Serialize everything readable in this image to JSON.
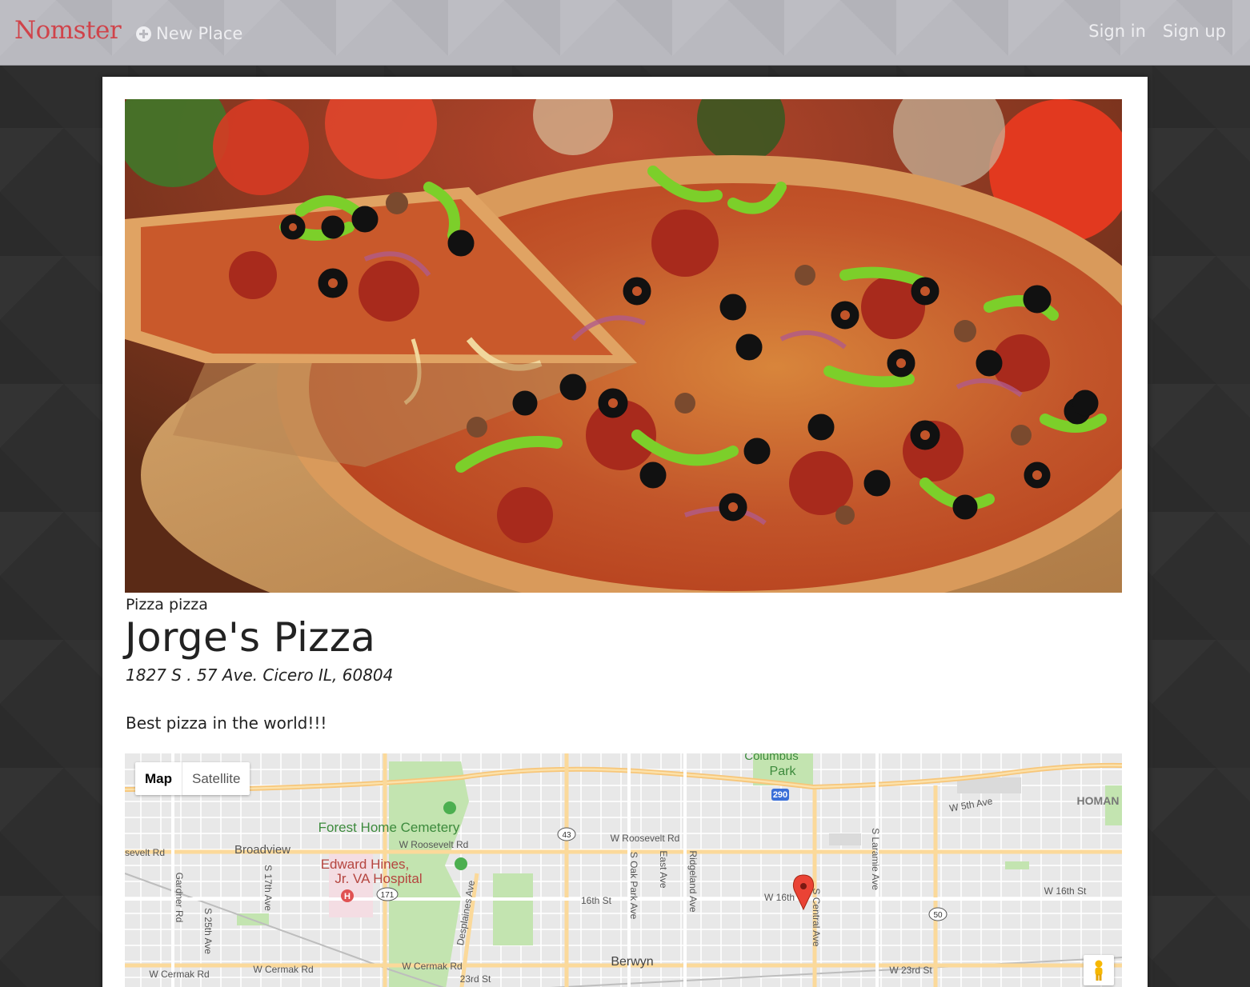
{
  "navbar": {
    "brand": "Nomster",
    "new_place": "New Place",
    "sign_in": "Sign in",
    "sign_up": "Sign up"
  },
  "place": {
    "category": "Pizza pizza",
    "name": "Jorge's Pizza",
    "address": "1827 S . 57 Ave. Cicero IL, 60804",
    "description": "Best pizza in the world!!!"
  },
  "map": {
    "map_button": "Map",
    "satellite_button": "Satellite",
    "labels": {
      "columbus": "Columbus",
      "park": "Park",
      "forest_home": "Forest Home Cemetery",
      "broadview": "Broadview",
      "hines_1": "Edward Hines,",
      "hines_2": "Jr. VA Hospital",
      "berwyn": "Berwyn",
      "w_roosevelt_rd": "W Roosevelt Rd",
      "w_roosevelt_rd_2": "W Roosevelt Rd",
      "sevelt_rd": "sevelt Rd",
      "w_5th_ave": "W 5th Ave",
      "homan": "HOMAN",
      "w_16th_st": "W 16th St",
      "w_16th": "W 16th",
      "16th_st": "16th St",
      "w_cermak_rd_1": "W Cermak Rd",
      "w_cermak_rd_2": "W Cermak Rd",
      "w_cermak_rd_3": "W Cermak Rd",
      "23rd_st": "23rd St",
      "w_23rd_st": "W 23rd St",
      "gardner_rd": "Gardner Rd",
      "s_17th_ave": "S 17th Ave",
      "s_25th_ave": "S 25th Ave",
      "desplaines_ave": "Desplaines Ave",
      "s_oak_park_ave": "S Oak Park Ave",
      "east_ave": "East Ave",
      "ridgeland_ave": "Ridgeland Ave",
      "s_central_ave": "S Central Ave",
      "s_laramie_ave": "S Laramie Ave",
      "shield_290": "290",
      "shield_43": "43",
      "shield_171": "171",
      "shield_50": "50"
    }
  },
  "colors": {
    "brand": "#d0434a",
    "navbar_bg": "#b9b9bf",
    "body_bg": "#2e2e2e",
    "map_marker": "#ea4335"
  }
}
